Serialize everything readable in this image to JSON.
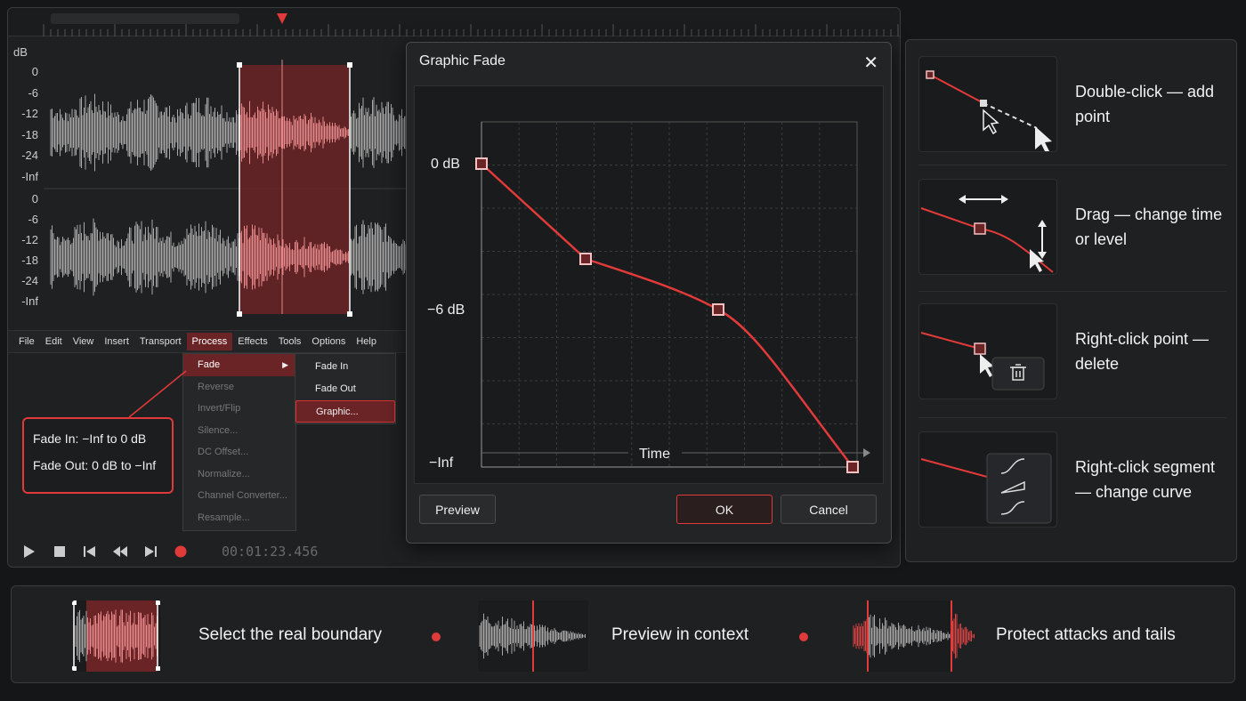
{
  "editor": {
    "db_label": "dB",
    "db_ticks_top": [
      "0",
      "-6",
      "-12",
      "-18",
      "-24",
      "-Inf"
    ],
    "db_ticks_bottom": [
      "0",
      "-6",
      "-12",
      "-18",
      "-24",
      "-Inf"
    ],
    "menu": [
      "File",
      "Edit",
      "View",
      "Insert",
      "Transport",
      "Process",
      "Effects",
      "Tools",
      "Options",
      "Help"
    ],
    "menu_active": "Process",
    "process_menu": [
      "Fade",
      "Reverse",
      "Invert/Flip",
      "Silence...",
      "DC Offset...",
      "Normalize...",
      "Channel Converter...",
      "Resample..."
    ],
    "fade_submenu": [
      "Fade In",
      "Fade Out",
      "Graphic..."
    ],
    "callout": {
      "fade_in": "Fade In:   −Inf to 0 dB",
      "fade_out": "Fade Out:  0 dB to −Inf"
    },
    "timecode": "00:01:23.456"
  },
  "dialog": {
    "title": "Graphic Fade",
    "y_labels": [
      "0 dB",
      "−6 dB",
      "−Inf"
    ],
    "x_label": "Time",
    "buttons": {
      "preview": "Preview",
      "ok": "OK",
      "cancel": "Cancel"
    },
    "curve_points_db": [
      0,
      -4.5,
      -6,
      -60
    ]
  },
  "tips": [
    {
      "text": "Double-click — add point",
      "icon": "add-point-icon"
    },
    {
      "text": "Drag — change time or level",
      "icon": "drag-point-icon"
    },
    {
      "text": "Right-click point — delete",
      "icon": "trash-icon"
    },
    {
      "text": "Right-click segment — change curve",
      "icon": "curve-shape-icon"
    }
  ],
  "bottom": [
    {
      "text": "Select the real boundary"
    },
    {
      "text": "Preview in context"
    },
    {
      "text": "Protect attacks and tails"
    }
  ],
  "colors": {
    "accent": "#e03a3a",
    "selection": "#6b2426",
    "wave": "#a8a8a8"
  }
}
